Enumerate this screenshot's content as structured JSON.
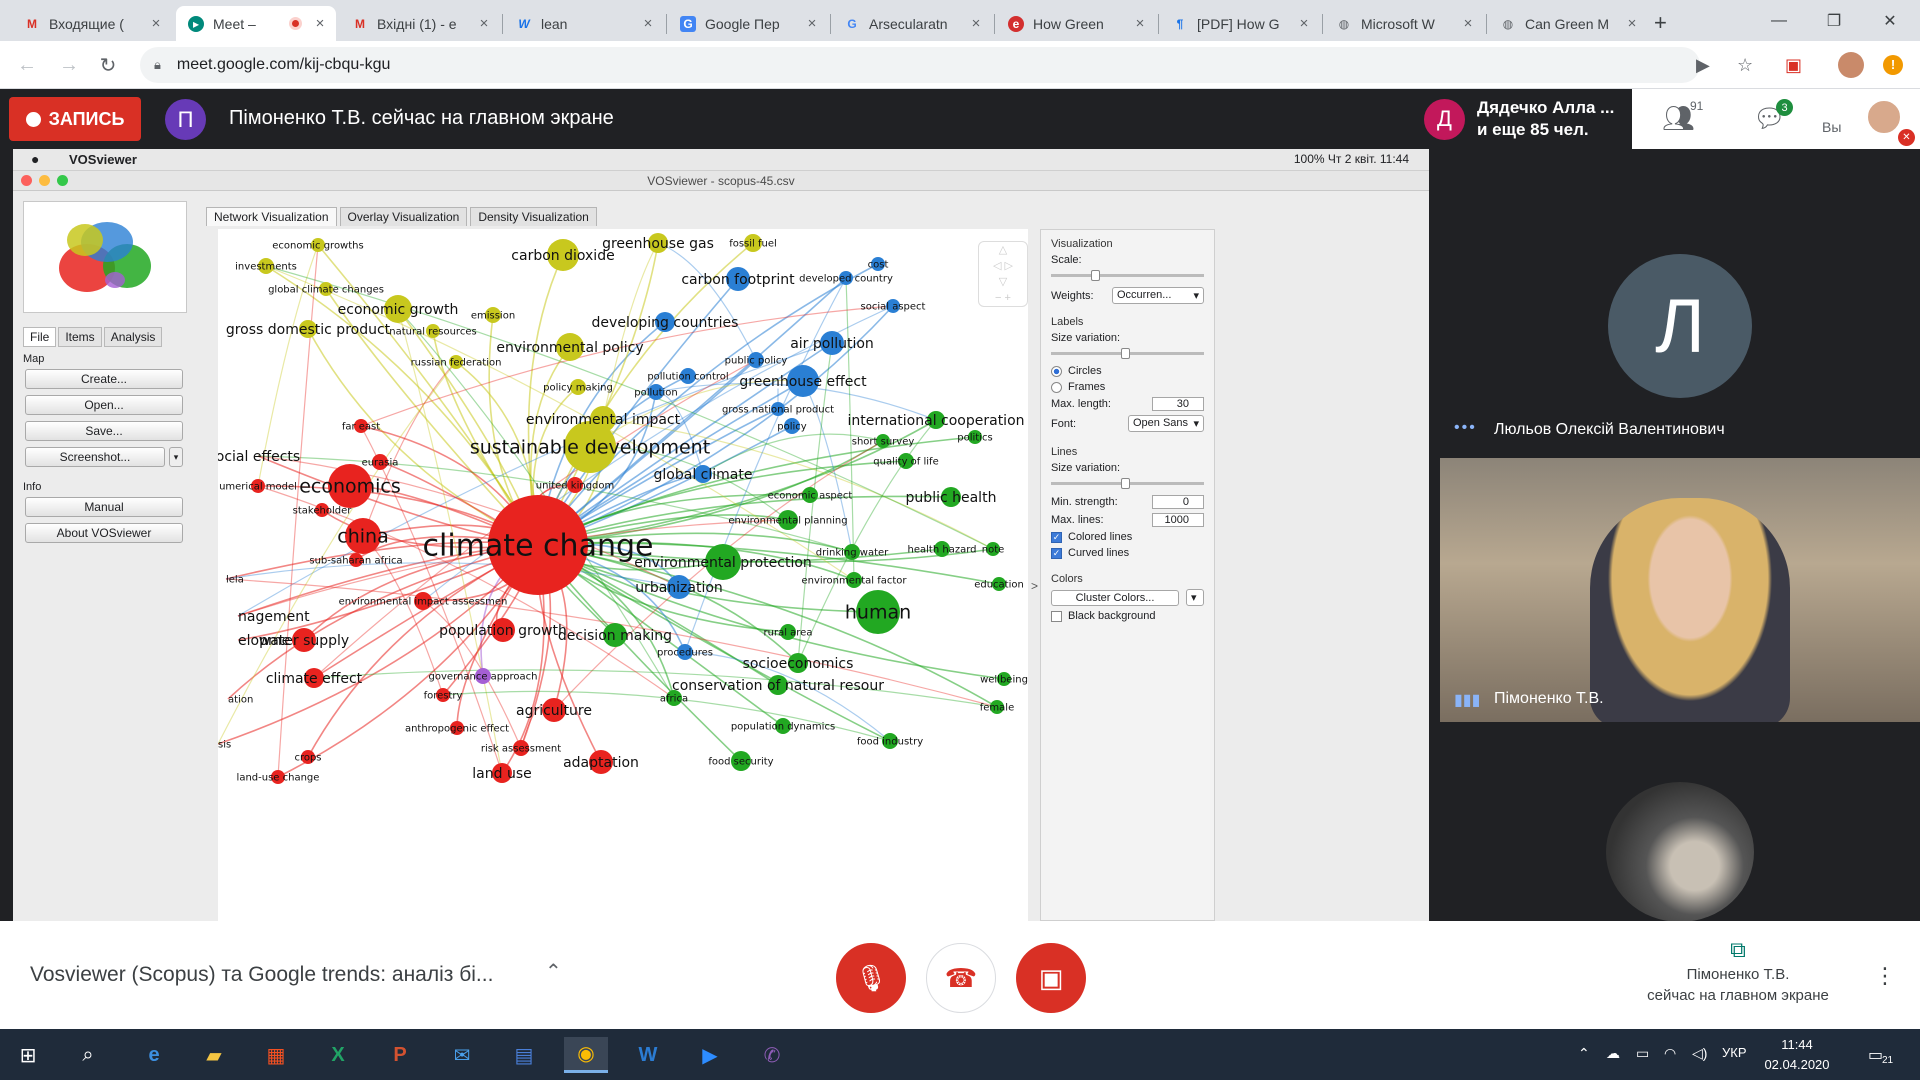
{
  "browser": {
    "tabs": [
      {
        "title": "Входящие (",
        "icon": "gmail-icon"
      },
      {
        "title": "Meet – ",
        "icon": "meet-icon"
      },
      {
        "title": "Вхідні (1) - e",
        "icon": "gmail-icon"
      },
      {
        "title": "lean",
        "icon": "wiki-icon"
      },
      {
        "title": "Google Пер",
        "icon": "translate-icon"
      },
      {
        "title": "Arsecularatn",
        "icon": "google-icon"
      },
      {
        "title": "How Green",
        "icon": "site-icon"
      },
      {
        "title": "[PDF] How G",
        "icon": "pdf-icon"
      },
      {
        "title": "Microsoft W",
        "icon": "globe-icon"
      },
      {
        "title": "Can Green M",
        "icon": "globe-icon"
      }
    ],
    "url": "meet.google.com/kij-cbqu-kgu"
  },
  "meet": {
    "record_label": "ЗАПИСЬ",
    "presenter_initial": "П",
    "presenter_text": "Пімоненко Т.В. сейчас на главном экране",
    "people_initial": "Д",
    "people_line1": "Дядечко Алла ...",
    "people_line2": "и еще 85 чел.",
    "people_count": "91",
    "chat_count": "3",
    "you_label": "Вы",
    "participants": [
      {
        "initial": "Л",
        "name": "Люльов Олексій Валентинович"
      },
      {
        "name": "Пімоненко Т.В."
      }
    ],
    "meeting_title": "Vosviewer (Scopus) та Google trends: аналіз бі...",
    "present_line1": "Пімоненко Т.В.",
    "present_line2": "сейчас на главном экране"
  },
  "vosviewer": {
    "app_name": "VOSviewer",
    "menubar_status": "100%   Чт 2 квіт.  11:44",
    "window_title": "VOSviewer - scopus-45.csv",
    "left_tabs": [
      "File",
      "Items",
      "Analysis"
    ],
    "map_label": "Map",
    "map_buttons": [
      "Create...",
      "Open...",
      "Save...",
      "Screenshot..."
    ],
    "info_label": "Info",
    "info_buttons": [
      "Manual",
      "About VOSviewer"
    ],
    "view_tabs": [
      "Network Visualization",
      "Overlay Visualization",
      "Density Visualization"
    ],
    "panel": {
      "visualization": "Visualization",
      "scale": "Scale:",
      "weights": "Weights:",
      "weights_value": "Occurren...",
      "labels": "Labels",
      "size_variation": "Size variation:",
      "circles": "Circles",
      "frames": "Frames",
      "max_length": "Max. length:",
      "max_length_value": "30",
      "font": "Font:",
      "font_value": "Open Sans",
      "lines": "Lines",
      "lines_size_variation": "Size variation:",
      "min_strength": "Min. strength:",
      "min_strength_value": "0",
      "max_lines": "Max. lines:",
      "max_lines_value": "1000",
      "colored_lines": "Colored lines",
      "curved_lines": "Curved lines",
      "colors": "Colors",
      "cluster_colors": "Cluster Colors...",
      "black_background": "Black background"
    },
    "clusters": {
      "red": "#e8231f",
      "green": "#22a822",
      "blue": "#2a7fd4",
      "yellow": "#c8c81e",
      "purple": "#a55fd4"
    },
    "labels": [
      {
        "t": "climate change",
        "c": "red",
        "s": 1
      },
      {
        "t": "sustainable development",
        "c": "yellow",
        "s": 2
      },
      {
        "t": "carbon dioxide",
        "c": "yellow",
        "s": 3
      },
      {
        "t": "economic growth",
        "c": "yellow",
        "s": 3
      },
      {
        "t": "economics",
        "c": "red",
        "s": 2
      },
      {
        "t": "china",
        "c": "red",
        "s": 2
      },
      {
        "t": "human",
        "c": "green",
        "s": 2
      },
      {
        "t": "greenhouse effect",
        "c": "blue",
        "s": 3
      },
      {
        "t": "environmental policy",
        "c": "yellow",
        "s": 3
      },
      {
        "t": "environmental impact",
        "c": "yellow",
        "s": 3
      },
      {
        "t": "developing countries",
        "c": "blue",
        "s": 3
      },
      {
        "t": "air pollution",
        "c": "blue",
        "s": 3
      },
      {
        "t": "carbon footprint",
        "c": "blue",
        "s": 3
      },
      {
        "t": "greenhouse gas",
        "c": "yellow",
        "s": 3
      },
      {
        "t": "fossil fuel",
        "c": "yellow",
        "s": 4
      },
      {
        "t": "ocial effects",
        "c": "red",
        "s": 3
      },
      {
        "t": "water supply",
        "c": "red",
        "s": 3
      },
      {
        "t": "climate effect",
        "c": "red",
        "s": 3
      },
      {
        "t": "population growth",
        "c": "red",
        "s": 3
      },
      {
        "t": "agriculture",
        "c": "red",
        "s": 3
      },
      {
        "t": "adaptation",
        "c": "red",
        "s": 3
      },
      {
        "t": "land use",
        "c": "red",
        "s": 3
      },
      {
        "t": "decision making",
        "c": "green",
        "s": 3
      },
      {
        "t": "urbanization",
        "c": "blue",
        "s": 3
      },
      {
        "t": "environmental protection",
        "c": "green",
        "s": 3
      },
      {
        "t": "socioeconomics",
        "c": "green",
        "s": 3
      },
      {
        "t": "conservation of natural resour",
        "c": "green",
        "s": 3
      },
      {
        "t": "international cooperation",
        "c": "green",
        "s": 3
      },
      {
        "t": "public health",
        "c": "green",
        "s": 3
      },
      {
        "t": "global climate",
        "c": "blue",
        "s": 3
      },
      {
        "t": "gross domestic product",
        "c": "yellow",
        "s": 3
      },
      {
        "t": "investments",
        "c": "yellow",
        "s": 4
      },
      {
        "t": "global climate changes",
        "c": "yellow",
        "s": 4
      },
      {
        "t": "economic growths",
        "c": "yellow",
        "s": 4
      },
      {
        "t": "natural resources",
        "c": "yellow",
        "s": 4
      },
      {
        "t": "russian federation",
        "c": "yellow",
        "s": 4
      },
      {
        "t": "emission",
        "c": "yellow",
        "s": 4
      },
      {
        "t": "public policy",
        "c": "blue",
        "s": 4
      },
      {
        "t": "policy making",
        "c": "yellow",
        "s": 4
      },
      {
        "t": "pollution",
        "c": "blue",
        "s": 4
      },
      {
        "t": "pollution control",
        "c": "blue",
        "s": 4
      },
      {
        "t": "gross national product",
        "c": "blue",
        "s": 4
      },
      {
        "t": "policy",
        "c": "blue",
        "s": 4
      },
      {
        "t": "developed country",
        "c": "blue",
        "s": 4
      },
      {
        "t": "cost",
        "c": "blue",
        "s": 4
      },
      {
        "t": "social aspect",
        "c": "blue",
        "s": 4
      },
      {
        "t": "economic aspect",
        "c": "green",
        "s": 4
      },
      {
        "t": "environmental planning",
        "c": "green",
        "s": 4
      },
      {
        "t": "health hazard",
        "c": "green",
        "s": 4
      },
      {
        "t": "drinking water",
        "c": "green",
        "s": 4
      },
      {
        "t": "quality of life",
        "c": "green",
        "s": 4
      },
      {
        "t": "short survey",
        "c": "green",
        "s": 4
      },
      {
        "t": "politics",
        "c": "green",
        "s": 4
      },
      {
        "t": "environmental factor",
        "c": "green",
        "s": 4
      },
      {
        "t": "rural area",
        "c": "green",
        "s": 4
      },
      {
        "t": "procedures",
        "c": "blue",
        "s": 4
      },
      {
        "t": "population dynamics",
        "c": "green",
        "s": 4
      },
      {
        "t": "food industry",
        "c": "green",
        "s": 4
      },
      {
        "t": "food security",
        "c": "green",
        "s": 4
      },
      {
        "t": "africa",
        "c": "green",
        "s": 4
      },
      {
        "t": "wellbeing",
        "c": "green",
        "s": 4
      },
      {
        "t": "female",
        "c": "green",
        "s": 4
      },
      {
        "t": "education",
        "c": "green",
        "s": 4
      },
      {
        "t": "note",
        "c": "green",
        "s": 4
      },
      {
        "t": "eurasia",
        "c": "red",
        "s": 4
      },
      {
        "t": "far east",
        "c": "red",
        "s": 4
      },
      {
        "t": "stakeholder",
        "c": "red",
        "s": 4
      },
      {
        "t": "umerical model",
        "c": "red",
        "s": 4
      },
      {
        "t": "sub-saharan africa",
        "c": "red",
        "s": 4
      },
      {
        "t": "environmental impact assessmen",
        "c": "red",
        "s": 4
      },
      {
        "t": "governance approach",
        "c": "purple",
        "s": 4
      },
      {
        "t": "forestry",
        "c": "red",
        "s": 4
      },
      {
        "t": "anthropogenic effect",
        "c": "red",
        "s": 4
      },
      {
        "t": "risk assessment",
        "c": "red",
        "s": 4
      },
      {
        "t": "crops",
        "c": "red",
        "s": 4
      },
      {
        "t": "land-use change",
        "c": "red",
        "s": 4
      },
      {
        "t": "united kingdom",
        "c": "red",
        "s": 4
      },
      {
        "t": "nagement",
        "c": "red",
        "s": 3
      },
      {
        "t": "elopme",
        "c": "red",
        "s": 3
      },
      {
        "t": "lela",
        "c": "red",
        "s": 4
      },
      {
        "t": "ation",
        "c": "red",
        "s": 4
      },
      {
        "t": "sis",
        "c": "red",
        "s": 4
      }
    ]
  },
  "taskbar": {
    "lang": "УКР",
    "time": "11:44",
    "date": "02.04.2020",
    "notifications": "21"
  }
}
